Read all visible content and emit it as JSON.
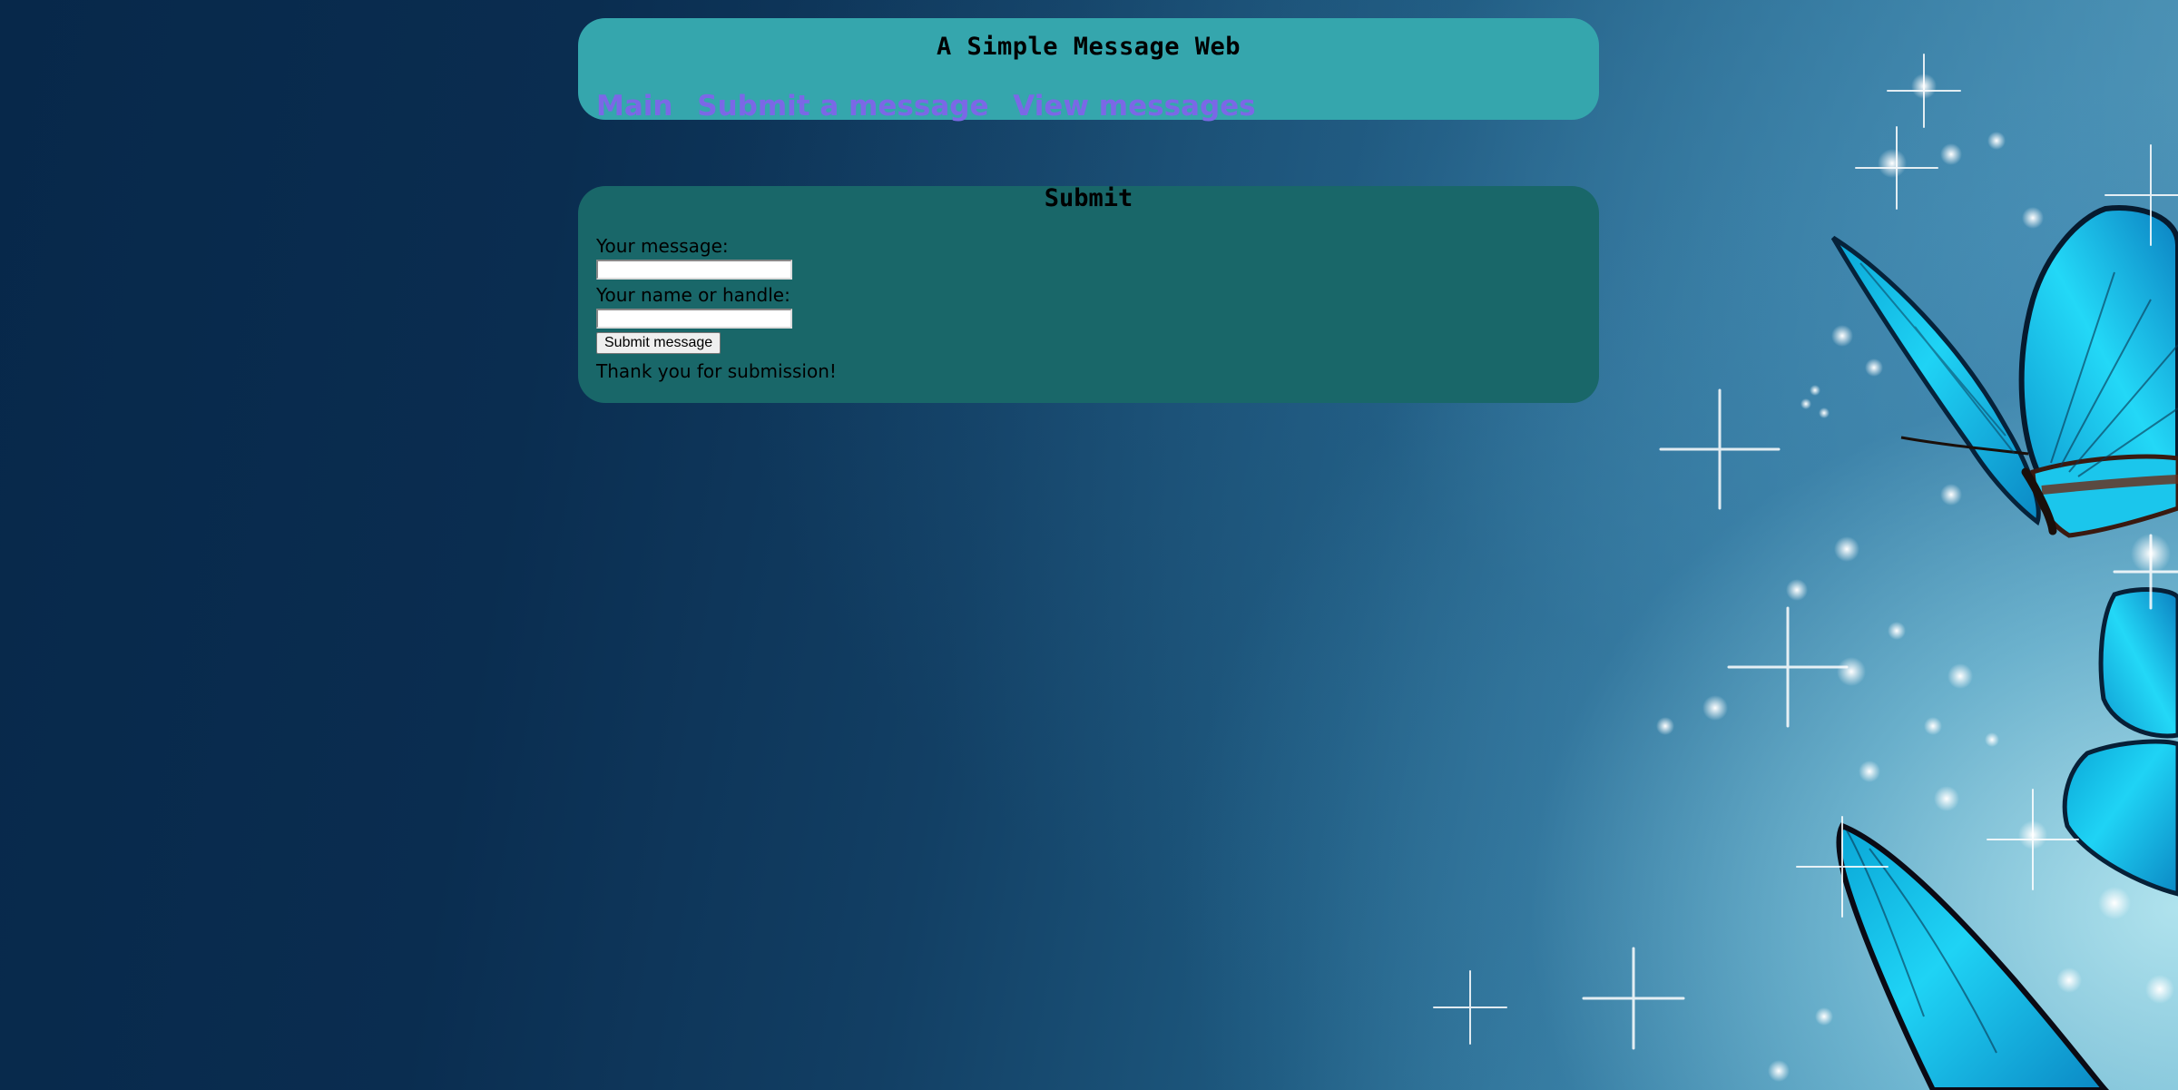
{
  "header": {
    "site_title": "A Simple Message Web",
    "nav": [
      {
        "label": "Main"
      },
      {
        "label": "Submit a message"
      },
      {
        "label": "View messages"
      }
    ]
  },
  "submit": {
    "title": "Submit",
    "message_label": "Your message:",
    "message_value": "",
    "name_label": "Your name or handle:",
    "name_value": "",
    "button_label": "Submit message",
    "confirmation": "Thank you for submission!"
  },
  "colors": {
    "header_panel": "#35a6ad",
    "submit_panel": "#196769",
    "nav_link": "#7b68e6",
    "background_dark": "#07284a",
    "background_light": "#79bdd2",
    "butterfly_wing": "#1fd3f5"
  },
  "background": {
    "image": "butterfly-sparkle-wallpaper"
  }
}
